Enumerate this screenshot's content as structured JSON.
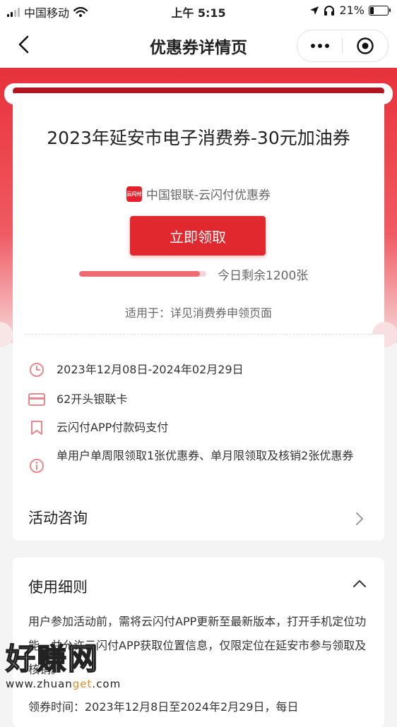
{
  "status_bar": {
    "carrier": "中国移动",
    "time": "上午 5:15",
    "battery_pct": "21%",
    "battery_level": 0.21
  },
  "nav": {
    "title": "优惠券详情页",
    "back_icon": "chevron-left-icon",
    "more_icon": "more-dots-icon",
    "close_icon": "target-close-icon"
  },
  "coupon": {
    "title": "2023年延安市电子消费券-30元加油券",
    "issuer": "中国银联-云闪付优惠券",
    "issuer_logo": "云闪付",
    "claim_label": "立即领取",
    "remaining_text": "今日剩余1200张",
    "progress_fraction": 0.95,
    "applicable_text": "适用于：详见消费券申领页面"
  },
  "info": {
    "items": [
      {
        "icon": "clock-icon",
        "text": "2023年12月08日-2024年02月29日"
      },
      {
        "icon": "card-icon",
        "text": "62开头银联卡"
      },
      {
        "icon": "bookmark-icon",
        "text": "云闪付APP付款码支付"
      },
      {
        "icon": "info-icon",
        "text": "单用户单周限领取1张优惠券、单月限领取及核销2张优惠券"
      }
    ],
    "consult_label": "活动咨询"
  },
  "rules": {
    "title": "使用细则",
    "body": "用户参加活动前，需将云闪付APP更新至最新版本，打开手机定位功能，并允许云闪付APP获取位置信息，仅限定位在延安市参与领取及核销。",
    "next_line": "领券时间：2023年12月8日至2024年2月29日，每日"
  },
  "watermark": {
    "brand": "好赚网",
    "url_prefix": "www.zhuan",
    "url_highlight": "get",
    "url_suffix": ".com"
  },
  "colors": {
    "primary_red": "#e2282f",
    "progress_bg": "#f4d5d7",
    "progress_fill": "#ef6b72"
  }
}
